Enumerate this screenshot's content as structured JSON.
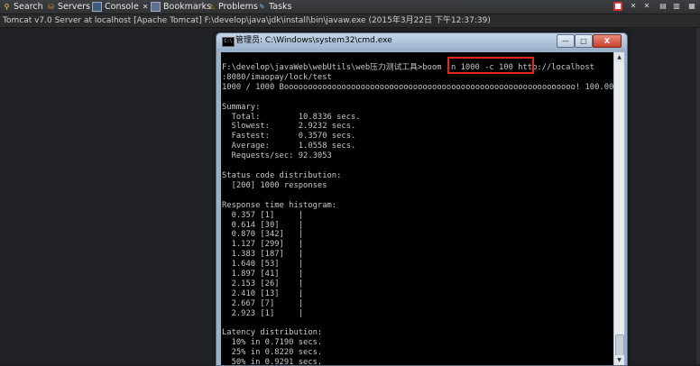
{
  "eclipse": {
    "tabs": [
      {
        "label": "Search"
      },
      {
        "label": "Servers"
      },
      {
        "label": "Console"
      },
      {
        "label": "Bookmarks"
      },
      {
        "label": "Problems"
      },
      {
        "label": "Tasks"
      }
    ],
    "console_title": "Tomcat v7.0 Server at localhost [Apache Tomcat] F:\\develop\\java\\jdk\\install\\bin\\javaw.exe (2015年3月22日 下午12:37:39)"
  },
  "cmd_window": {
    "title": "管理员: C:\\Windows\\system32\\cmd.exe",
    "buttons": {
      "minimize": "—",
      "maximize": "□",
      "close": "X"
    },
    "output": "F:\\develop\\javaWeb\\webUtils\\web压力测试工具>boom -n 1000 -c 100 http://localhost\n:8080/imaopay/lock/test\n1000 / 1000 Booooooooooooooooooooooooooooooooooooooooooooooooooooooooooooo! 100.00 %\n\nSummary:\n  Total:        10.8336 secs.\n  Slowest:      2.9232 secs.\n  Fastest:      0.3570 secs.\n  Average:      1.0558 secs.\n  Requests/sec: 92.3053\n\nStatus code distribution:\n  [200] 1000 responses\n\nResponse time histogram:\n  0.357 [1]     |\n  0.614 [30]    |\n  0.870 [342]   |\n  1.127 [299]   |\n  1.383 [187]   |\n  1.640 [53]    |\n  1.897 [41]    |\n  2.153 [26]    |\n  2.410 [13]    |\n  2.667 [7]     |\n  2.923 [1]     |\n\nLatency distribution:\n  10% in 0.7190 secs.\n  25% in 0.8220 secs.\n  50% in 0.9291 secs."
  },
  "colors": {
    "highlight": "#e8261c",
    "terminal_bg": "#000000",
    "terminal_fg": "#c6c6c6"
  }
}
